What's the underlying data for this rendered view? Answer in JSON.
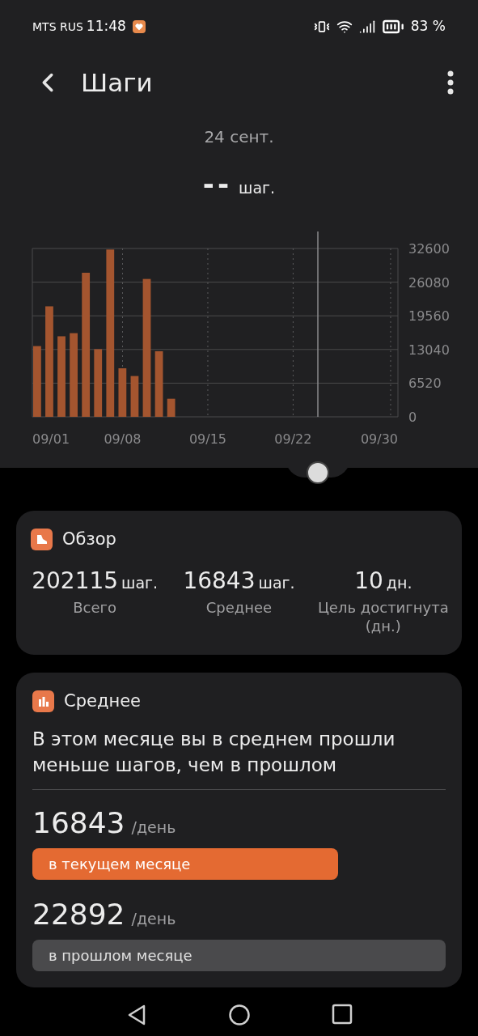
{
  "status_bar": {
    "carrier": "MTS RUS",
    "time": "11:48",
    "battery": "83 %"
  },
  "header": {
    "title": "Шаги"
  },
  "summary": {
    "date": "24 сент.",
    "value": "--",
    "unit": "шаг."
  },
  "chart_data": {
    "type": "bar",
    "categories": [
      "09/01",
      null,
      null,
      null,
      null,
      null,
      null,
      "09/08",
      null,
      null,
      null,
      null,
      null,
      null,
      "09/15",
      null,
      null,
      null,
      null,
      null,
      null,
      "09/22",
      null,
      null,
      null,
      null,
      null,
      null,
      null,
      "09/30"
    ],
    "series": [
      {
        "color": "#a4552f",
        "values": [
          13700,
          21400,
          15600,
          16200,
          27900,
          13100,
          32400,
          9400,
          7900,
          26700,
          12700,
          3500,
          null,
          null,
          null,
          null,
          null,
          null,
          null,
          null,
          null,
          null,
          null,
          null,
          null,
          null,
          null,
          null,
          null,
          null
        ]
      }
    ],
    "ylim": [
      0,
      32600
    ],
    "yticks": [
      0,
      6520,
      13040,
      19560,
      26080,
      32600
    ],
    "grid": true
  },
  "overview": {
    "title": "Обзор",
    "stats": [
      {
        "value": "202115",
        "unit": "шаг.",
        "label": "Всего"
      },
      {
        "value": "16843",
        "unit": "шаг.",
        "label": "Среднее"
      },
      {
        "value": "10",
        "unit": "дн.",
        "label": "Цель достигнута (дн.)"
      }
    ]
  },
  "average": {
    "title": "Среднее",
    "message": "В этом месяце вы в среднем прошли меньше шагов, чем в прошлом",
    "rows": [
      {
        "value": "16843",
        "unit": "/день",
        "label": "в текущем месяце",
        "kind": "current"
      },
      {
        "value": "22892",
        "unit": "/день",
        "label": "в прошлом месяце",
        "kind": "previous"
      }
    ]
  }
}
